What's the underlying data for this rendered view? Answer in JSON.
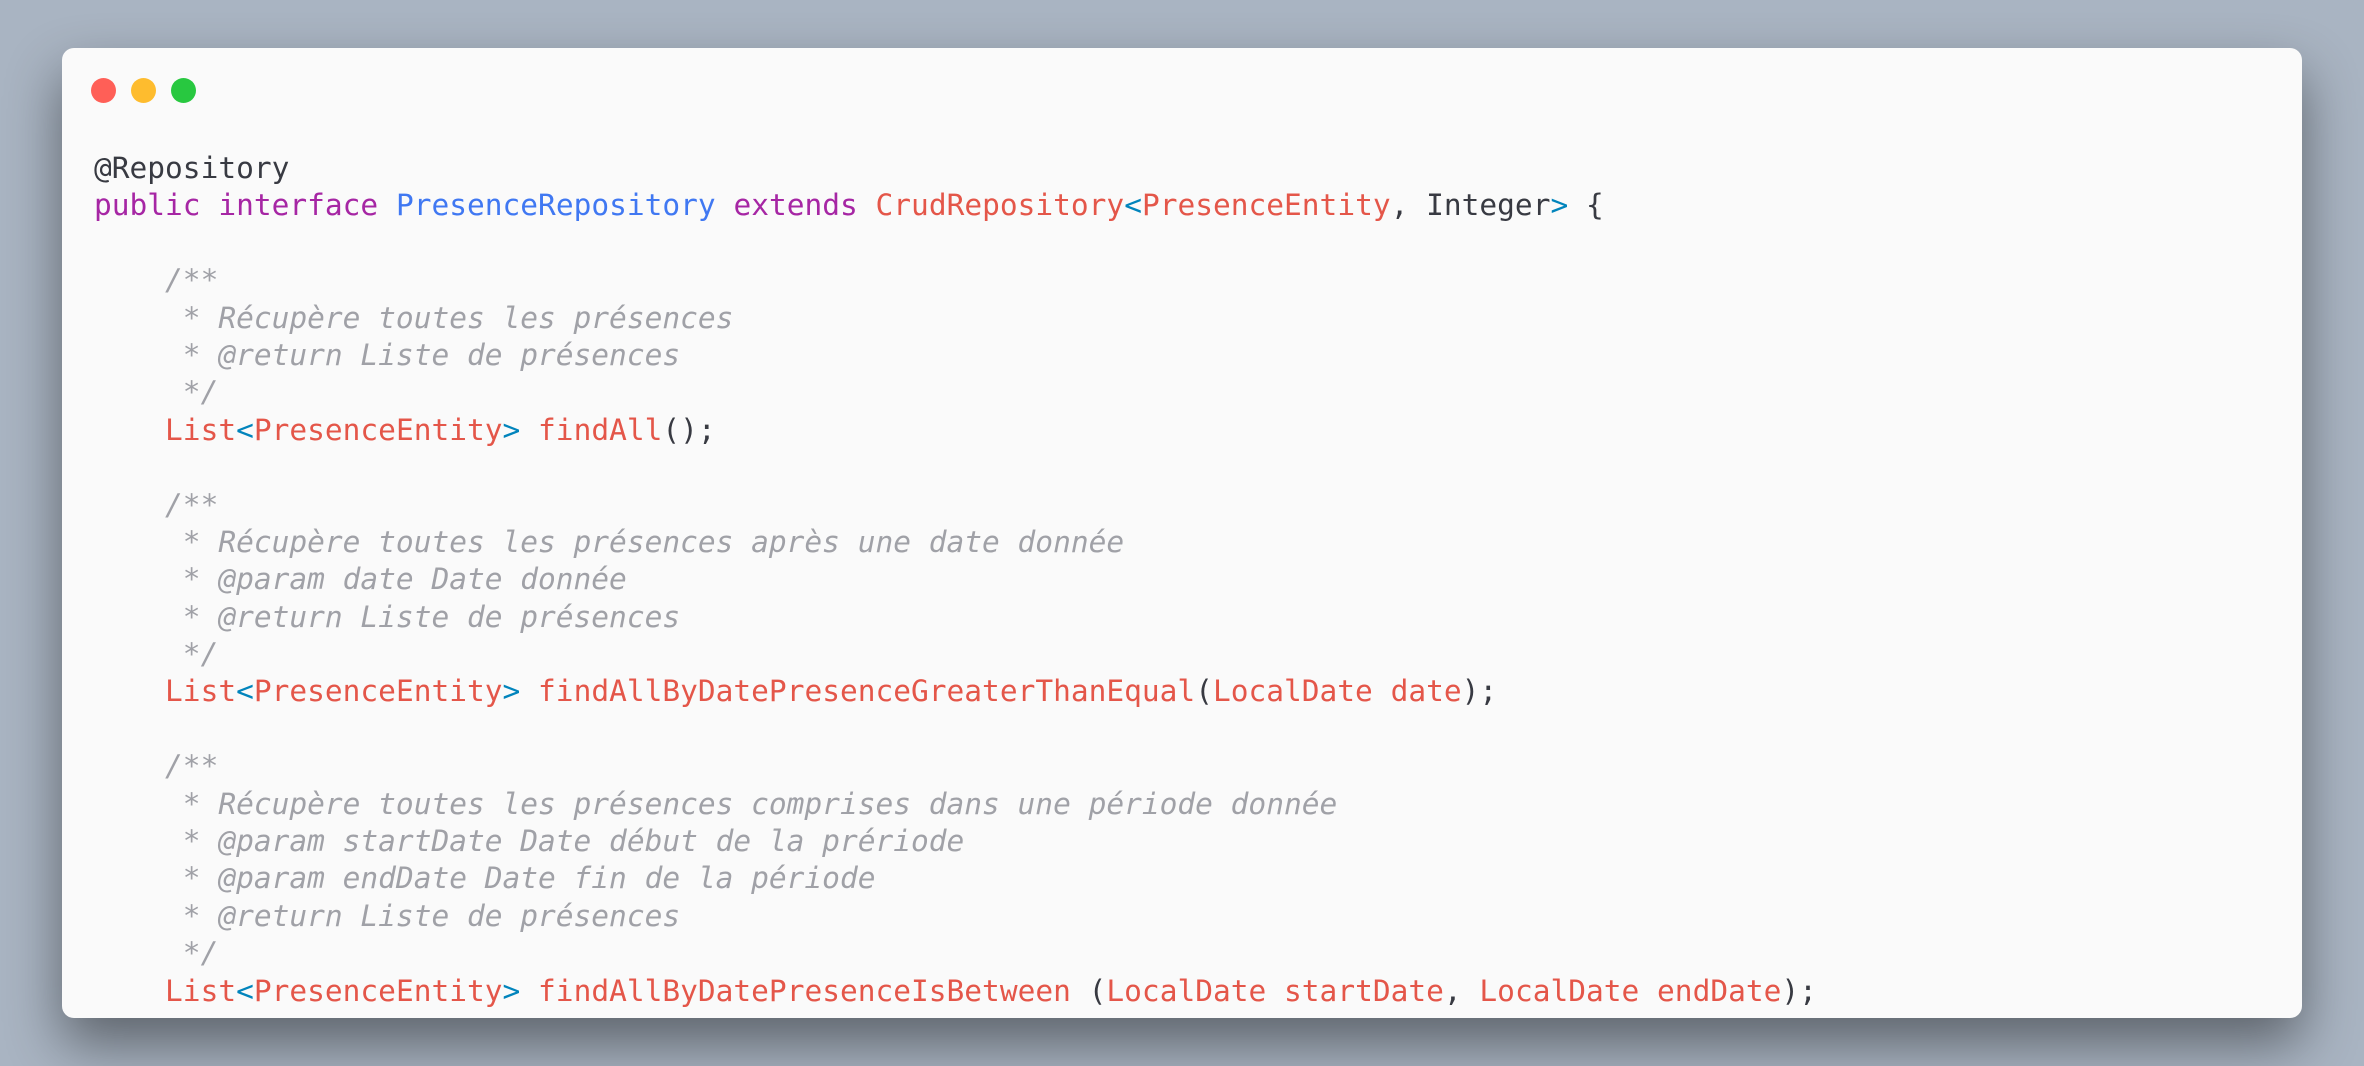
{
  "window": {
    "controls": [
      {
        "name": "close-button",
        "color": "#ff5f57"
      },
      {
        "name": "minimize-button",
        "color": "#febc2e"
      },
      {
        "name": "maximize-button",
        "color": "#28c840"
      }
    ]
  },
  "colors": {
    "background": "#a9b4c2",
    "window": "#fafafa",
    "keyword": "#a626a4",
    "class": "#4078f2",
    "type": "#e45649",
    "punctuation": "#0184bc",
    "comment": "#a0a1a7",
    "plain": "#383a42"
  },
  "code": {
    "language": "java",
    "lines": [
      [
        {
          "t": "@Repository",
          "k": "plain"
        }
      ],
      [
        {
          "t": "public",
          "k": "keyword"
        },
        {
          "t": " ",
          "k": "plain"
        },
        {
          "t": "interface",
          "k": "keyword"
        },
        {
          "t": " ",
          "k": "plain"
        },
        {
          "t": "PresenceRepository",
          "k": "class"
        },
        {
          "t": " ",
          "k": "plain"
        },
        {
          "t": "extends",
          "k": "keyword"
        },
        {
          "t": " ",
          "k": "plain"
        },
        {
          "t": "CrudRepository",
          "k": "type"
        },
        {
          "t": "<",
          "k": "punct"
        },
        {
          "t": "PresenceEntity",
          "k": "type"
        },
        {
          "t": ", Integer",
          "k": "plain"
        },
        {
          "t": ">",
          "k": "punct"
        },
        {
          "t": " {",
          "k": "plain"
        }
      ],
      [],
      [
        {
          "t": "    /**",
          "k": "comment"
        }
      ],
      [
        {
          "t": "     * Récupère toutes les présences",
          "k": "comment"
        }
      ],
      [
        {
          "t": "     * @return Liste de présences",
          "k": "comment"
        }
      ],
      [
        {
          "t": "     */",
          "k": "comment"
        }
      ],
      [
        {
          "t": "    ",
          "k": "plain"
        },
        {
          "t": "List",
          "k": "type"
        },
        {
          "t": "<",
          "k": "punct"
        },
        {
          "t": "PresenceEntity",
          "k": "type"
        },
        {
          "t": ">",
          "k": "punct"
        },
        {
          "t": " ",
          "k": "plain"
        },
        {
          "t": "findAll",
          "k": "func"
        },
        {
          "t": "();",
          "k": "plain"
        }
      ],
      [],
      [
        {
          "t": "    /**",
          "k": "comment"
        }
      ],
      [
        {
          "t": "     * Récupère toutes les présences après une date donnée",
          "k": "comment"
        }
      ],
      [
        {
          "t": "     * @param date Date donnée",
          "k": "comment"
        }
      ],
      [
        {
          "t": "     * @return Liste de présences",
          "k": "comment"
        }
      ],
      [
        {
          "t": "     */",
          "k": "comment"
        }
      ],
      [
        {
          "t": "    ",
          "k": "plain"
        },
        {
          "t": "List",
          "k": "type"
        },
        {
          "t": "<",
          "k": "punct"
        },
        {
          "t": "PresenceEntity",
          "k": "type"
        },
        {
          "t": ">",
          "k": "punct"
        },
        {
          "t": " ",
          "k": "plain"
        },
        {
          "t": "findAllByDatePresenceGreaterThanEqual",
          "k": "func"
        },
        {
          "t": "(",
          "k": "plain"
        },
        {
          "t": "LocalDate",
          "k": "type"
        },
        {
          "t": " ",
          "k": "plain"
        },
        {
          "t": "date",
          "k": "param"
        },
        {
          "t": ");",
          "k": "plain"
        }
      ],
      [],
      [
        {
          "t": "    /**",
          "k": "comment"
        }
      ],
      [
        {
          "t": "     * Récupère toutes les présences comprises dans une période donnée",
          "k": "comment"
        }
      ],
      [
        {
          "t": "     * @param startDate Date début de la prériode",
          "k": "comment"
        }
      ],
      [
        {
          "t": "     * @param endDate Date fin de la période",
          "k": "comment"
        }
      ],
      [
        {
          "t": "     * @return Liste de présences",
          "k": "comment"
        }
      ],
      [
        {
          "t": "     */",
          "k": "comment"
        }
      ],
      [
        {
          "t": "    ",
          "k": "plain"
        },
        {
          "t": "List",
          "k": "type"
        },
        {
          "t": "<",
          "k": "punct"
        },
        {
          "t": "PresenceEntity",
          "k": "type"
        },
        {
          "t": ">",
          "k": "punct"
        },
        {
          "t": " ",
          "k": "plain"
        },
        {
          "t": "findAllByDatePresenceIsBetween",
          "k": "func"
        },
        {
          "t": " (",
          "k": "plain"
        },
        {
          "t": "LocalDate",
          "k": "type"
        },
        {
          "t": " ",
          "k": "plain"
        },
        {
          "t": "startDate",
          "k": "param"
        },
        {
          "t": ", ",
          "k": "plain"
        },
        {
          "t": "LocalDate",
          "k": "type"
        },
        {
          "t": " ",
          "k": "plain"
        },
        {
          "t": "endDate",
          "k": "param"
        },
        {
          "t": ");",
          "k": "plain"
        }
      ]
    ]
  }
}
